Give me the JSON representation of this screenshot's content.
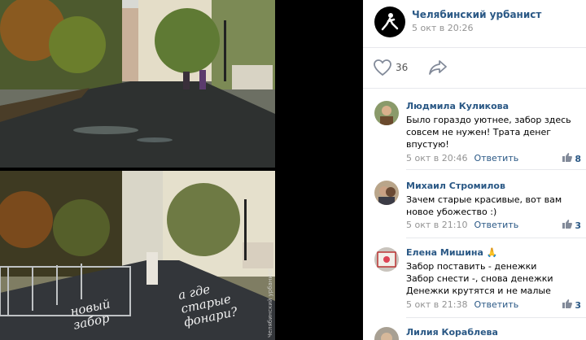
{
  "post": {
    "group_name": "Челябинский урбанист",
    "date": "5 окт в 20:26",
    "likes": "36"
  },
  "photo": {
    "annotation_fence": "новый\nзабор",
    "annotation_lamps": "а где\nстарые\nфонари?",
    "watermark": "Челябинский урбанист"
  },
  "comments": [
    {
      "author": "Людмила Куликова",
      "text": "Было гораздо уютнее, забор здесь совсем не нужен! Трата денег впустую!",
      "date": "5 окт в 20:46",
      "reply": "Ответить",
      "likes": "8"
    },
    {
      "author": "Михаил Стромилов",
      "text": "Зачем старые красивые, вот вам новое убожество :)",
      "date": "5 окт в 21:10",
      "reply": "Ответить",
      "likes": "3"
    },
    {
      "author": "Елена Мишина 🙏",
      "text": "Забор поставить - денежки\nЗабор снести -, снова денежки\nДенежки крутятся и не малые",
      "date": "5 окт в 21:38",
      "reply": "Ответить",
      "likes": "3"
    },
    {
      "author": "Лилия Кораблева",
      "text": "",
      "date": "",
      "reply": "",
      "likes": ""
    }
  ],
  "colors": {
    "link": "#2a5885",
    "meta": "#939393"
  },
  "icons": [
    "group-logo-icon",
    "heart-icon",
    "share-icon",
    "like-small-icon"
  ]
}
